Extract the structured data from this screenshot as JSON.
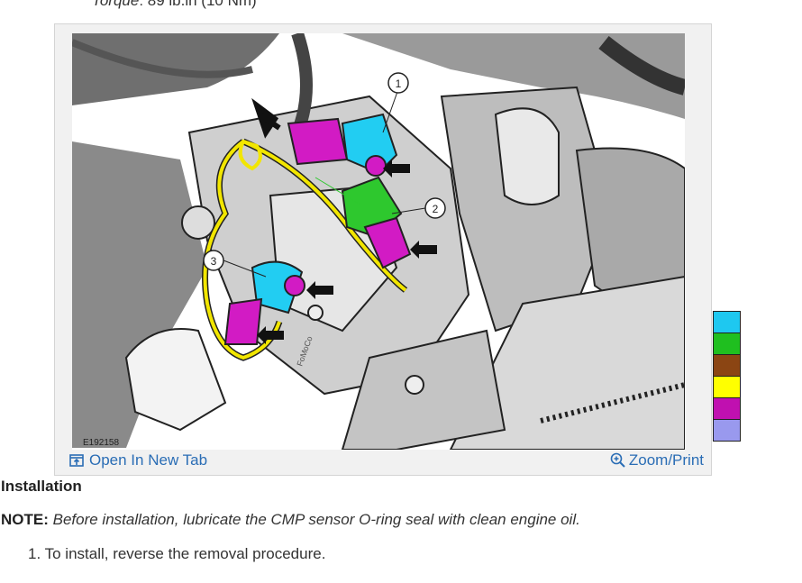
{
  "torque": {
    "label": "Torque",
    "value": ": 89 lb.in (10 Nm)"
  },
  "figure": {
    "id": "E192158",
    "callouts": [
      "1",
      "2",
      "3"
    ],
    "brand_mark": "FoMoCo",
    "open_tab_label": "Open In New Tab",
    "zoom_label": "Zoom/Print"
  },
  "legend": {
    "colors": [
      "#1ec8f0",
      "#1fbf1f",
      "#8b4513",
      "#ffff00",
      "#c010b0",
      "#9999ee"
    ]
  },
  "installation": {
    "heading": "Installation",
    "note_label": "NOTE:",
    "note_text": " Before installation, lubricate the CMP sensor O-ring seal with clean engine oil.",
    "steps": [
      {
        "number": "1.",
        "text": "To install, reverse the removal procedure."
      }
    ]
  }
}
